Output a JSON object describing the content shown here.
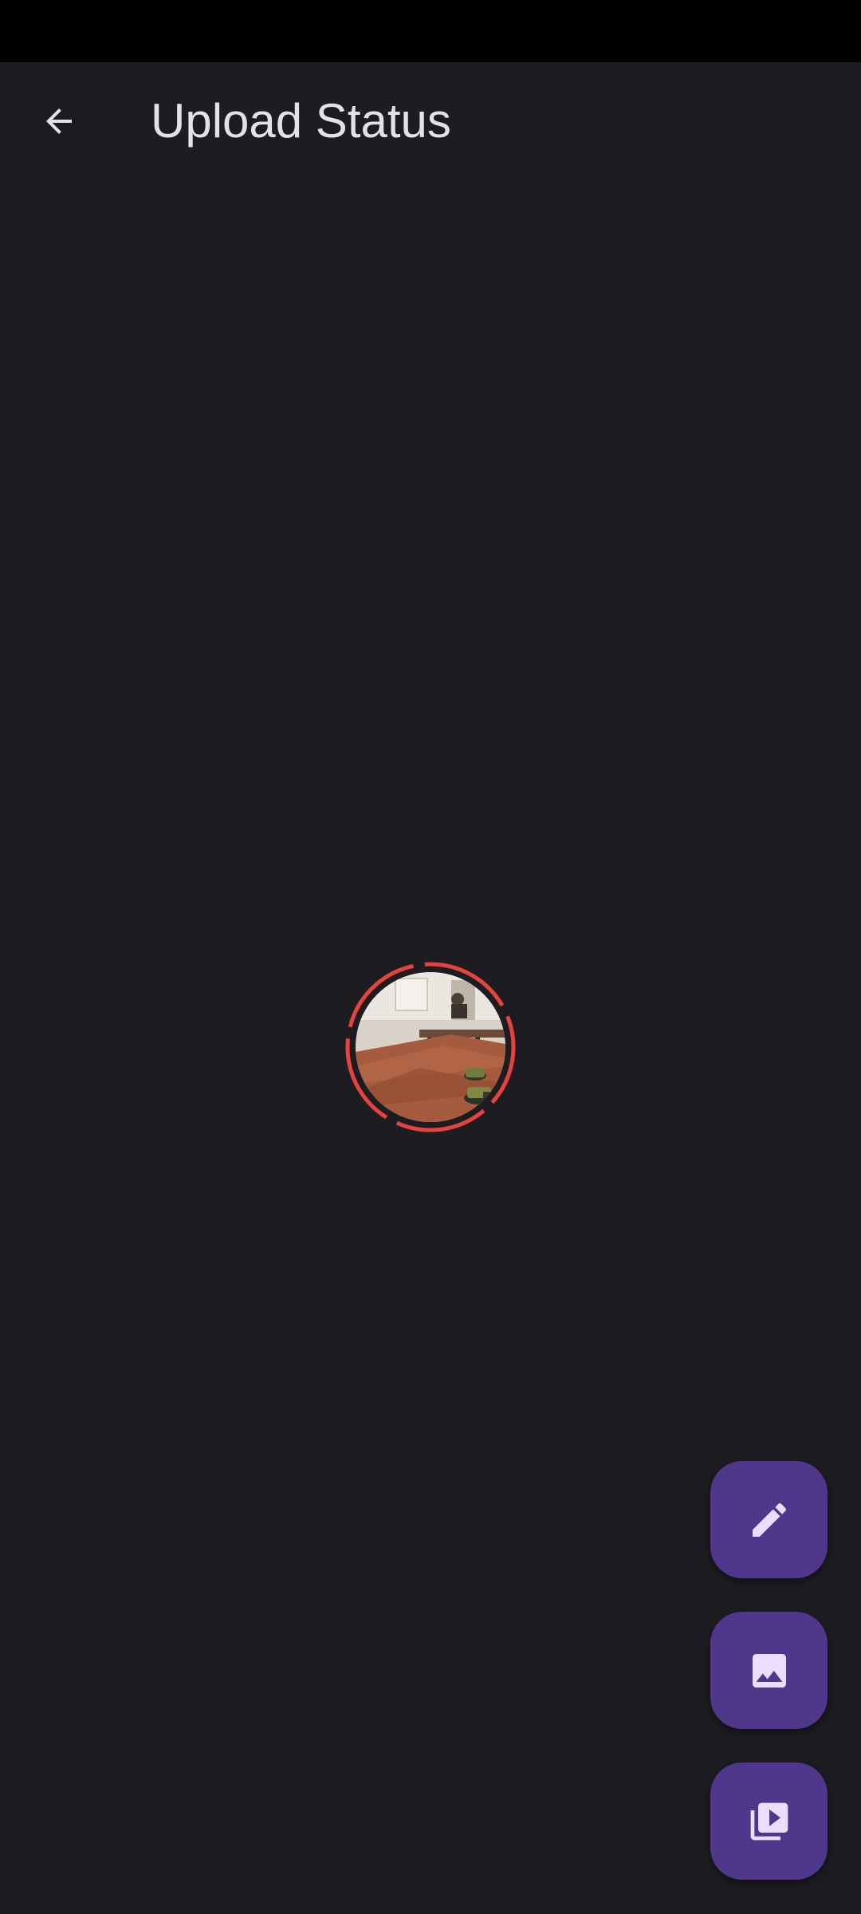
{
  "header": {
    "title": "Upload Status"
  },
  "icons": {
    "back": "arrow-back-icon",
    "edit": "pencil-icon",
    "image": "image-icon",
    "video": "video-library-icon"
  },
  "colors": {
    "background": "#1d1c21",
    "status_bar": "#000000",
    "title_text": "#e6e1e8",
    "ring": "#e5443e",
    "fab": "#4f378b",
    "fab_icon": "#eaddff"
  }
}
